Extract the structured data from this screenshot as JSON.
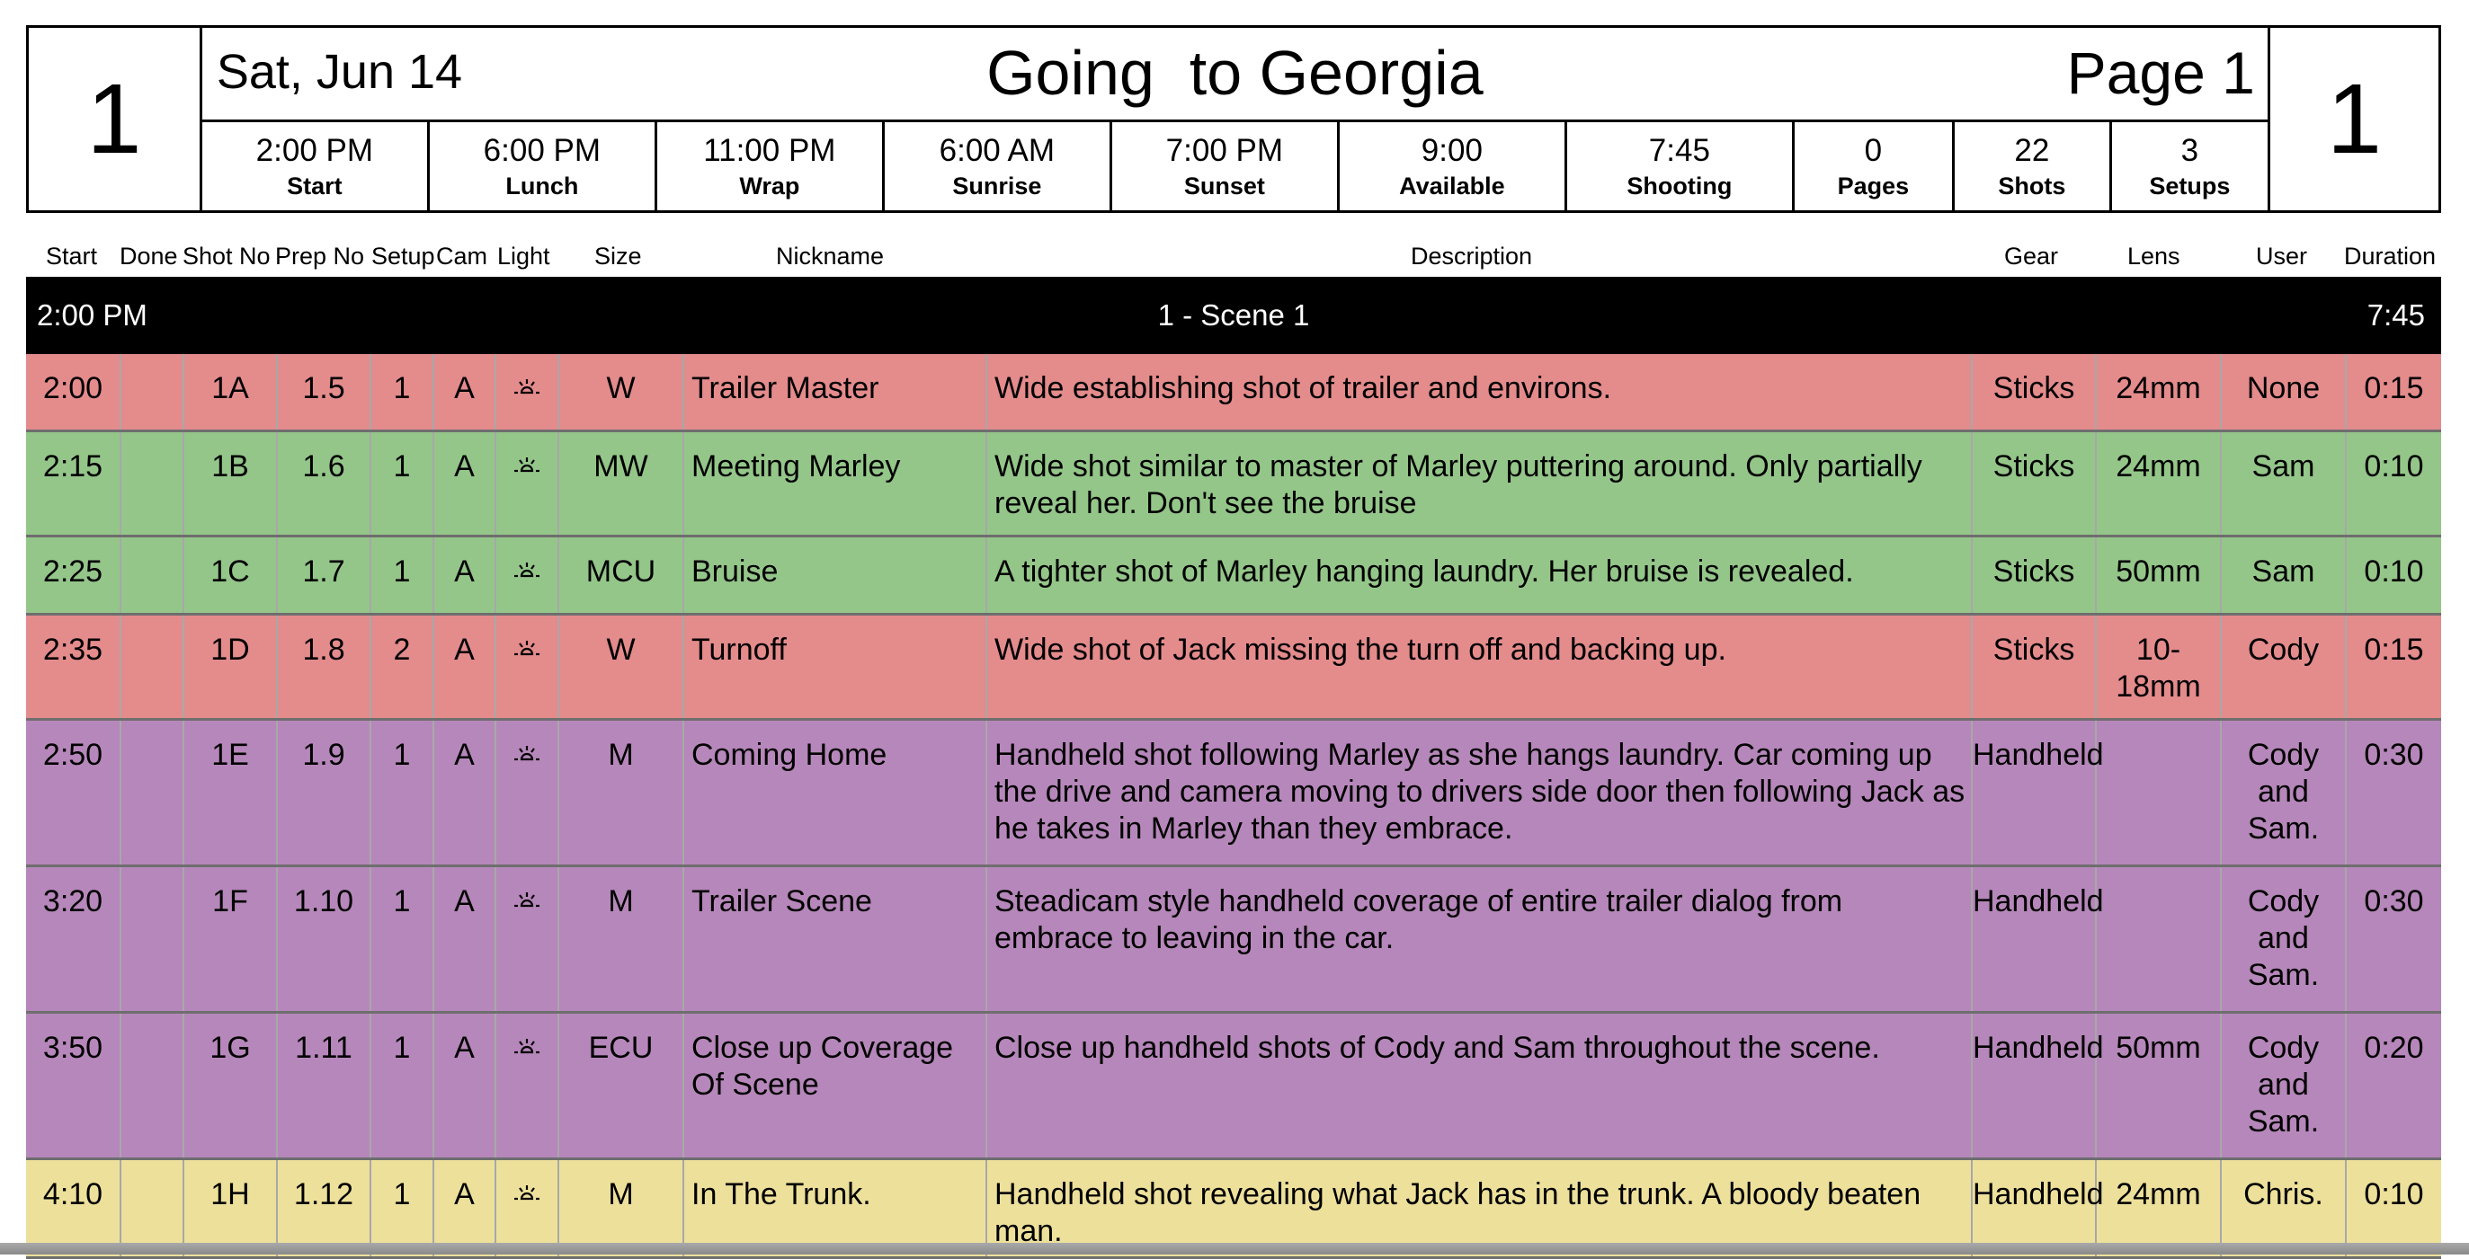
{
  "header": {
    "day_number_left": "1",
    "day_number_right": "1",
    "date": "Sat, Jun 14",
    "title": "Going  to Georgia",
    "page": "Page 1",
    "stats": [
      {
        "value": "2:00 PM",
        "label": "Start"
      },
      {
        "value": "6:00 PM",
        "label": "Lunch"
      },
      {
        "value": "11:00 PM",
        "label": "Wrap"
      },
      {
        "value": "6:00 AM",
        "label": "Sunrise"
      },
      {
        "value": "7:00 PM",
        "label": "Sunset"
      },
      {
        "value": "9:00",
        "label": "Available"
      },
      {
        "value": "7:45",
        "label": "Shooting"
      },
      {
        "value": "0",
        "label": "Pages"
      },
      {
        "value": "22",
        "label": "Shots"
      },
      {
        "value": "3",
        "label": "Setups"
      }
    ]
  },
  "columns": [
    "Start",
    "Done",
    "Shot No",
    "Prep No",
    "Setup",
    "Cam",
    "Light",
    "Size",
    "Nickname",
    "Description",
    "Gear",
    "Lens",
    "User",
    "Duration"
  ],
  "scene": {
    "start": "2:00 PM",
    "title": "1 - Scene 1",
    "duration": "7:45"
  },
  "colors": {
    "red": "#e48b8c",
    "green": "#94c689",
    "purple": "#b687ba",
    "yellow": "#ede09b"
  },
  "rows": [
    {
      "start": "2:00",
      "done": "",
      "shot": "1A",
      "prep": "1.5",
      "setup": "1",
      "cam": "A",
      "light": "sun-icon",
      "size": "W",
      "nickname": "Trailer Master",
      "description": "Wide establishing shot of trailer and environs.",
      "gear": "Sticks",
      "lens": "24mm",
      "user": "None",
      "duration": "0:15",
      "color": "red"
    },
    {
      "start": "2:15",
      "done": "",
      "shot": "1B",
      "prep": "1.6",
      "setup": "1",
      "cam": "A",
      "light": "sun-icon",
      "size": "MW",
      "nickname": "Meeting Marley",
      "description": "Wide shot similar to master of Marley puttering around. Only partially reveal her. Don't see the bruise",
      "gear": "Sticks",
      "lens": "24mm",
      "user": "Sam",
      "duration": "0:10",
      "color": "green"
    },
    {
      "start": "2:25",
      "done": "",
      "shot": "1C",
      "prep": "1.7",
      "setup": "1",
      "cam": "A",
      "light": "sun-icon",
      "size": "MCU",
      "nickname": "Bruise",
      "description": "A tighter shot of Marley hanging laundry. Her bruise is revealed.",
      "gear": "Sticks",
      "lens": "50mm",
      "user": "Sam",
      "duration": "0:10",
      "color": "green"
    },
    {
      "start": "2:35",
      "done": "",
      "shot": "1D",
      "prep": "1.8",
      "setup": "2",
      "cam": "A",
      "light": "sun-icon",
      "size": "W",
      "nickname": "Turnoff",
      "description": "Wide shot of Jack missing the turn off and backing up.",
      "gear": "Sticks",
      "lens": "10-18mm",
      "user": "Cody",
      "duration": "0:15",
      "color": "red"
    },
    {
      "start": "2:50",
      "done": "",
      "shot": "1E",
      "prep": "1.9",
      "setup": "1",
      "cam": "A",
      "light": "sun-icon",
      "size": "M",
      "nickname": "Coming Home",
      "description": "Handheld shot following Marley as she hangs laundry. Car coming up the drive and camera moving to drivers side door then following Jack as he takes in Marley than they embrace.",
      "gear": "Handheld",
      "lens": "",
      "user": "Cody and Sam.",
      "duration": "0:30",
      "color": "purple"
    },
    {
      "start": "3:20",
      "done": "",
      "shot": "1F",
      "prep": "1.10",
      "setup": "1",
      "cam": "A",
      "light": "sun-icon",
      "size": "M",
      "nickname": "Trailer Scene",
      "description": "Steadicam style handheld coverage of entire trailer dialog from embrace to leaving in the car.",
      "gear": "Handheld",
      "lens": "",
      "user": "Cody and Sam.",
      "duration": "0:30",
      "color": "purple"
    },
    {
      "start": "3:50",
      "done": "",
      "shot": "1G",
      "prep": "1.11",
      "setup": "1",
      "cam": "A",
      "light": "sun-icon",
      "size": "ECU",
      "nickname": "Close up Coverage Of Scene",
      "description": "Close up handheld shots of Cody and Sam throughout the scene.",
      "gear": "Handheld",
      "lens": "50mm",
      "user": "Cody and Sam.",
      "duration": "0:20",
      "color": "purple"
    },
    {
      "start": "4:10",
      "done": "",
      "shot": "1H",
      "prep": "1.12",
      "setup": "1",
      "cam": "A",
      "light": "sun-icon",
      "size": "M",
      "nickname": "In The Trunk.",
      "description": "Handheld shot revealing what Jack has in the trunk. A bloody beaten man.",
      "gear": "Handheld",
      "lens": "24mm",
      "user": "Chris.",
      "duration": "0:10",
      "color": "yellow"
    }
  ]
}
